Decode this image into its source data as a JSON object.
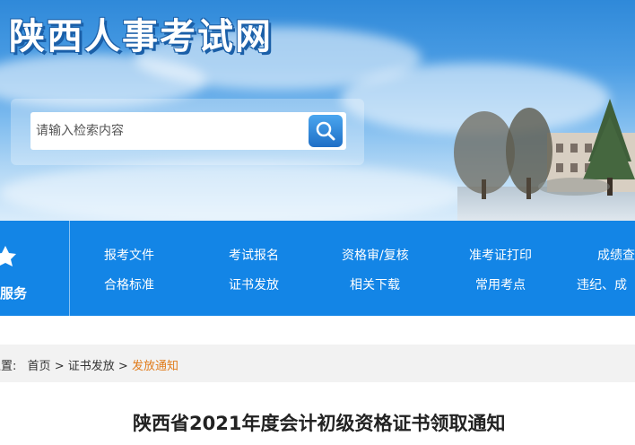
{
  "header": {
    "site_title": "陕西人事考试网"
  },
  "search": {
    "placeholder": "请输入检索内容",
    "button_icon": "search-icon"
  },
  "nav": {
    "side_label": "服务",
    "side_icon": "star-icon",
    "row1": [
      "报考文件",
      "考试报名",
      "资格审/复核",
      "准考证打印",
      "成绩查"
    ],
    "row2": [
      "合格标准",
      "证书发放",
      "相关下载",
      "常用考点",
      "违纪、成"
    ]
  },
  "breadcrumb": {
    "prefix": "位置:",
    "home": "首页",
    "sep1": ">",
    "section": "证书发放",
    "sep2": ">",
    "current": "发放通知"
  },
  "article": {
    "title": "陕西省2021年度会计初级资格证书领取通知"
  },
  "colors": {
    "nav_bg": "#1385e6",
    "breadcrumb_current": "#e07b1a"
  }
}
